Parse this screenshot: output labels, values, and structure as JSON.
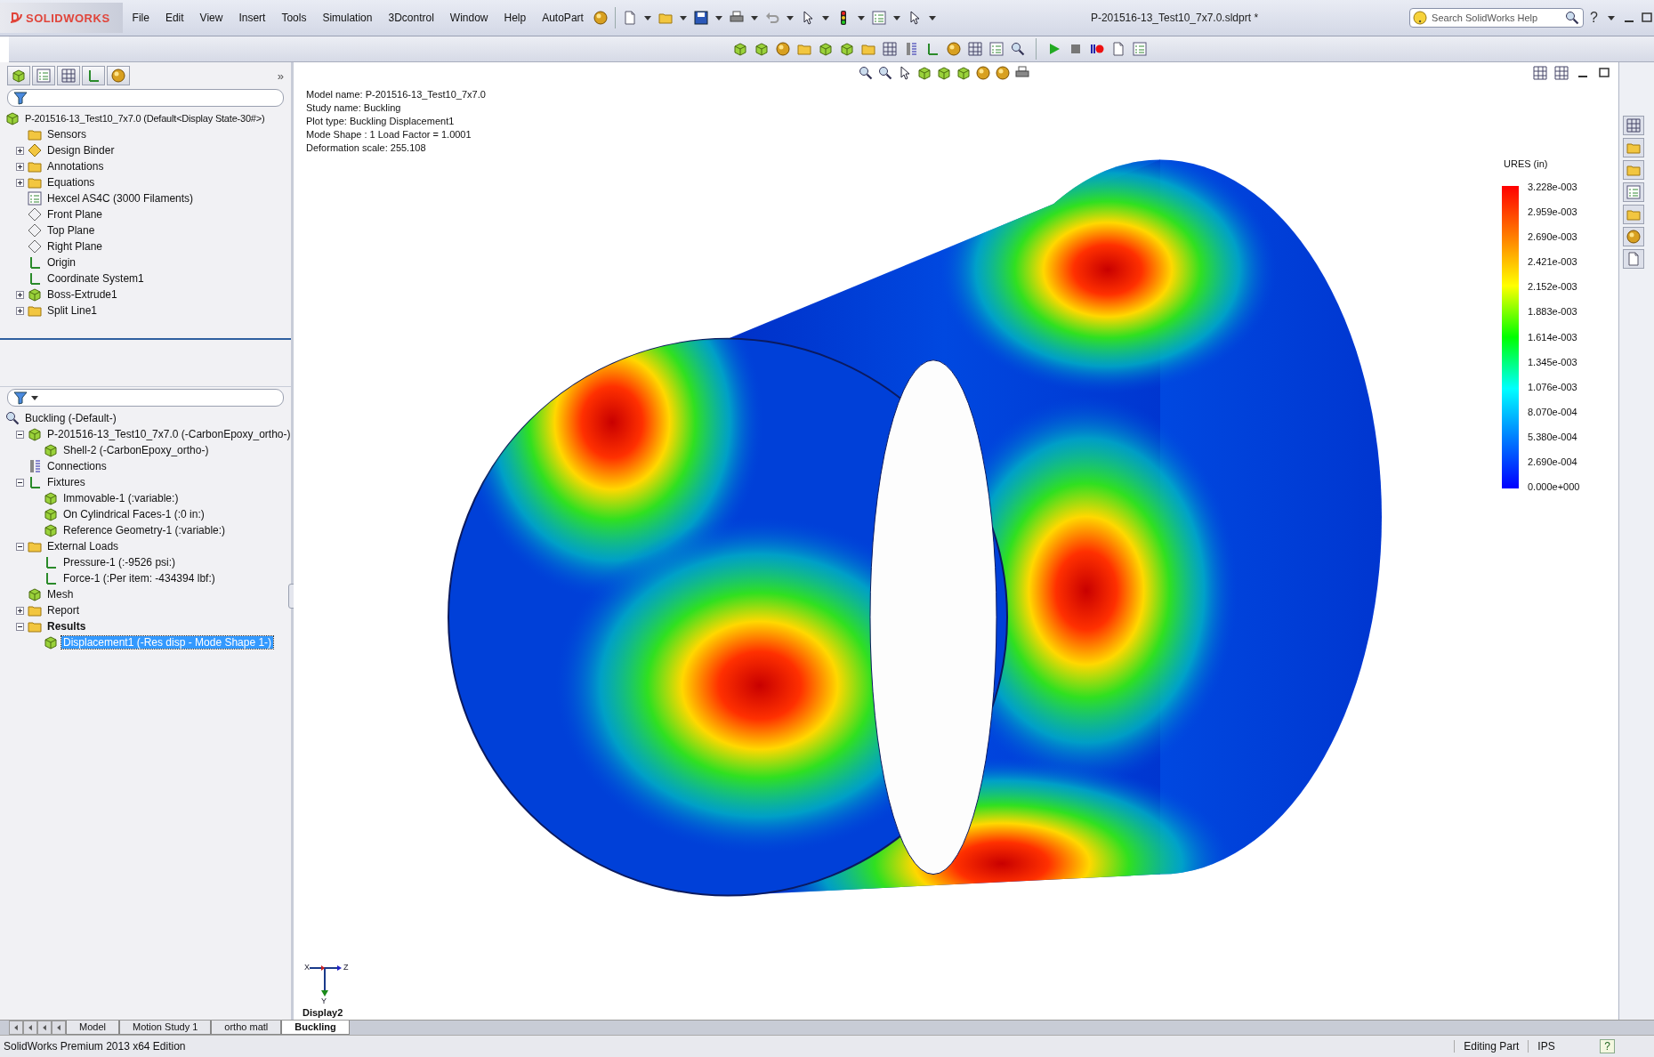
{
  "app": {
    "logo": "SOLIDWORKS",
    "menu": [
      "File",
      "Edit",
      "View",
      "Insert",
      "Tools",
      "Simulation",
      "3Dcontrol",
      "Window",
      "Help",
      "AutoPart"
    ],
    "title": "P-201516-13_Test10_7x7.0.sldprt *",
    "search": {
      "placeholder": "Search SolidWorks Help"
    },
    "help": "?"
  },
  "panel": {
    "overflow": "»",
    "feature_tree": {
      "root": "P-201516-13_Test10_7x7.0  (Default<Display State-30#>)",
      "items": [
        {
          "label": "Sensors",
          "kind": "leaf"
        },
        {
          "label": "Design Binder",
          "kind": "node",
          "expanded": false
        },
        {
          "label": "Annotations",
          "kind": "node",
          "expanded": false
        },
        {
          "label": "Equations",
          "kind": "node",
          "expanded": false
        },
        {
          "label": "Hexcel AS4C (3000 Filaments)",
          "kind": "leaf"
        },
        {
          "label": "Front Plane",
          "kind": "leaf"
        },
        {
          "label": "Top Plane",
          "kind": "leaf"
        },
        {
          "label": "Right Plane",
          "kind": "leaf"
        },
        {
          "label": "Origin",
          "kind": "leaf"
        },
        {
          "label": "Coordinate System1",
          "kind": "leaf"
        },
        {
          "label": "Boss-Extrude1",
          "kind": "node",
          "expanded": false
        },
        {
          "label": "Split Line1",
          "kind": "node",
          "expanded": false
        }
      ]
    },
    "study_tree": {
      "root": {
        "label": "Buckling (-Default-)",
        "selected": false
      },
      "items": [
        {
          "label": "P-201516-13_Test10_7x7.0 (-CarbonEpoxy_ortho-)",
          "kind": "node",
          "expanded": true,
          "bold": false,
          "selected": false,
          "children": [
            {
              "label": "Shell-2 (-CarbonEpoxy_ortho-)",
              "kind": "leaf",
              "bold": false,
              "selected": false
            }
          ]
        },
        {
          "label": "Connections",
          "kind": "leaf",
          "bold": false,
          "selected": false
        },
        {
          "label": "Fixtures",
          "kind": "node",
          "expanded": true,
          "bold": false,
          "selected": false,
          "children": [
            {
              "label": "Immovable-1 (:variable:)",
              "kind": "leaf",
              "bold": false,
              "selected": false
            },
            {
              "label": "On Cylindrical Faces-1 (:0 in:)",
              "kind": "leaf",
              "bold": false,
              "selected": false
            },
            {
              "label": "Reference Geometry-1 (:variable:)",
              "kind": "leaf",
              "bold": false,
              "selected": false
            }
          ]
        },
        {
          "label": "External Loads",
          "kind": "node",
          "expanded": true,
          "bold": false,
          "selected": false,
          "children": [
            {
              "label": "Pressure-1 (:-9526 psi:)",
              "kind": "leaf",
              "bold": false,
              "selected": false
            },
            {
              "label": "Force-1 (:Per item: -434394 lbf:)",
              "kind": "leaf",
              "bold": false,
              "selected": false
            }
          ]
        },
        {
          "label": "Mesh",
          "kind": "leaf",
          "bold": false,
          "selected": false
        },
        {
          "label": "Report",
          "kind": "node",
          "expanded": false,
          "bold": false,
          "selected": false
        },
        {
          "label": "Results",
          "kind": "node",
          "expanded": true,
          "bold": true,
          "selected": false,
          "children": [
            {
              "label": "Displacement1 (-Res disp - Mode Shape 1-)",
              "kind": "leaf",
              "bold": false,
              "selected": true
            }
          ]
        }
      ]
    }
  },
  "viewport": {
    "info": [
      "Model name: P-201516-13_Test10_7x7.0",
      "Study name: Buckling",
      "Plot type: Buckling Displacement1",
      "Mode Shape : 1  Load Factor = 1.0001",
      "Deformation scale: 255.108"
    ],
    "legend": {
      "title": "URES (in)",
      "labels": [
        "3.228e-003",
        "2.959e-003",
        "2.690e-003",
        "2.421e-003",
        "2.152e-003",
        "1.883e-003",
        "1.614e-003",
        "1.345e-003",
        "1.076e-003",
        "8.070e-004",
        "5.380e-004",
        "2.690e-004",
        "0.000e+000"
      ]
    },
    "triad": {
      "axes": [
        "X",
        "Y",
        "Z"
      ],
      "caption": "Display2"
    }
  },
  "bottom_tabs": [
    {
      "label": "Model",
      "selected": false
    },
    {
      "label": "Motion Study 1",
      "selected": false
    },
    {
      "label": "ortho matl",
      "selected": false
    },
    {
      "label": "Buckling",
      "selected": true
    }
  ],
  "status_bar": {
    "product": "SolidWorks Premium 2013 x64 Edition",
    "mode": "Editing Part",
    "units": "IPS",
    "help": "?"
  }
}
